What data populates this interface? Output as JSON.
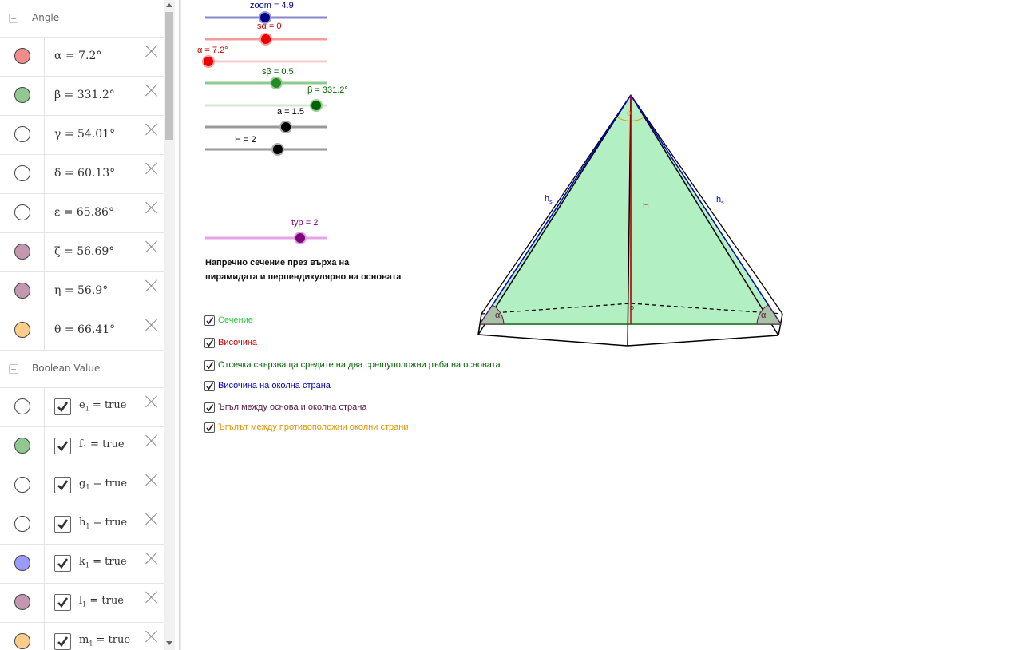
{
  "algebra": {
    "angle_group": {
      "title": "Angle",
      "items": [
        {
          "expr": "α = 7.2°",
          "color": "#f28b8b"
        },
        {
          "expr": "β = 331.2°",
          "color": "#8fc98f"
        },
        {
          "expr": "γ = 54.01°",
          "color": "#ffffff"
        },
        {
          "expr": "δ = 60.13°",
          "color": "#ffffff"
        },
        {
          "expr": "ε = 65.86°",
          "color": "#ffffff"
        },
        {
          "expr": "ζ = 56.69°",
          "color": "#c497b0"
        },
        {
          "expr": "η = 56.9°",
          "color": "#c497b0"
        },
        {
          "expr": "θ = 66.41°",
          "color": "#ffcc8a"
        }
      ]
    },
    "boolean_group": {
      "title": "Boolean Value",
      "items": [
        {
          "name": "e",
          "sub": "1",
          "rest": " = true",
          "color": "#ffffff"
        },
        {
          "name": "f",
          "sub": "1",
          "rest": " = true",
          "color": "#8fc98f"
        },
        {
          "name": "g",
          "sub": "1",
          "rest": " = true",
          "color": "#ffffff"
        },
        {
          "name": "h",
          "sub": "1",
          "rest": " = true",
          "color": "#ffffff"
        },
        {
          "name": "k",
          "sub": "1",
          "rest": " = true",
          "color": "#9a9aff"
        },
        {
          "name": "l",
          "sub": "1",
          "rest": " = true",
          "color": "#c497b0"
        },
        {
          "name": "m",
          "sub": "1",
          "rest": " = true",
          "color": "#ffcc8a"
        }
      ]
    }
  },
  "sliders": {
    "zoom": {
      "label": "zoom = 4.9",
      "color": "#00008b",
      "value": 4.9
    },
    "salpha": {
      "label": "sα = 0",
      "color": "#cc0000",
      "value": 0
    },
    "alpha": {
      "label": "α = 7.2°",
      "color": "#cc0000",
      "value": 7.2
    },
    "sbeta": {
      "label": "sβ = 0.5",
      "color": "#006400",
      "value": 0.5
    },
    "beta": {
      "label": "β = 331.2°",
      "color": "#006400",
      "value": 331.2
    },
    "a": {
      "label": "a = 1.5",
      "color": "#000000",
      "value": 1.5
    },
    "H": {
      "label": "H = 2",
      "color": "#000000",
      "value": 2
    },
    "typ": {
      "label": "typ = 2",
      "color": "#800080",
      "value": 2
    }
  },
  "section_text": {
    "line1": "Напречно сечение през върха на",
    "line2": "пирамидата и перпендикулярно на основата"
  },
  "checkboxes": [
    {
      "label": "Сечение",
      "color": "#2ecc40",
      "checked": true
    },
    {
      "label": "Височина",
      "color": "#cc0000",
      "checked": true
    },
    {
      "label": "Отсечка свързваща средите на два срещуположни ръба на основата",
      "color": "#006400",
      "checked": true
    },
    {
      "label": "Височина на околна страна",
      "color": "#0000cc",
      "checked": true
    },
    {
      "label": "Ъгъл между основа и околна страна",
      "color": "#5a1a3a",
      "checked": true
    },
    {
      "label": "Ъгълът между противоположни околни страни",
      "color": "#e69500",
      "checked": true
    }
  ],
  "figure": {
    "label_hs_left": "h",
    "label_hs_left_sub": "s",
    "label_hs_right": "h",
    "label_hs_right_sub": "s",
    "label_H": "H",
    "label_alpha_left": "α",
    "label_alpha_right": "α",
    "label_point": "o",
    "label_apex_angle": "θ",
    "section_color": "#b2f0c4"
  }
}
